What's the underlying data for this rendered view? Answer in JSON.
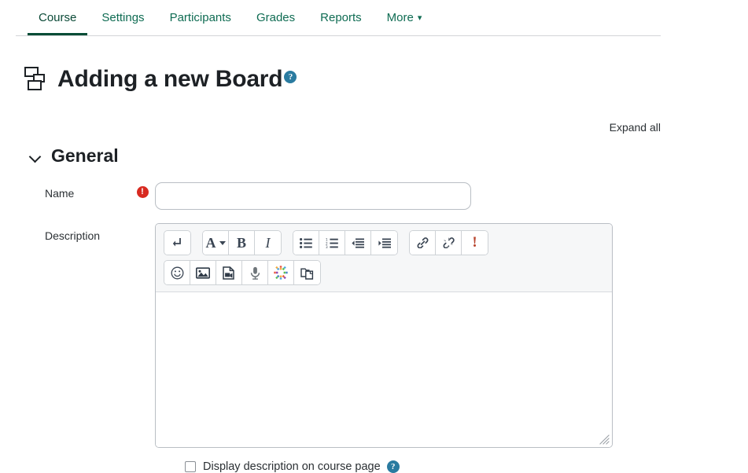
{
  "nav": {
    "tabs": [
      {
        "label": "Course",
        "active": true
      },
      {
        "label": "Settings",
        "active": false
      },
      {
        "label": "Participants",
        "active": false
      },
      {
        "label": "Grades",
        "active": false
      },
      {
        "label": "Reports",
        "active": false
      },
      {
        "label": "More",
        "active": false,
        "caret": "⌄"
      }
    ]
  },
  "header": {
    "title": "Adding a new Board",
    "icon": "board-icon",
    "help_glyph": "?",
    "expand_all": "Expand all"
  },
  "section": {
    "title": "General",
    "collapse_icon": "chevron-down-icon"
  },
  "fields": {
    "name": {
      "label": "Name",
      "value": "",
      "placeholder": "",
      "required_glyph": "!"
    },
    "description": {
      "label": "Description",
      "value": "",
      "placeholder": ""
    },
    "display_description": {
      "label": "Display description on course page",
      "checked": false,
      "help_glyph": "?"
    }
  },
  "editor": {
    "toolbar_rows": [
      [
        {
          "group": [
            {
              "name": "insert-line-break-button",
              "glyph": "⤵"
            }
          ]
        },
        {
          "group": [
            {
              "name": "style-dropdown-button",
              "glyph": "A"
            },
            {
              "name": "bold-button",
              "glyph": "B"
            },
            {
              "name": "italic-button",
              "glyph": "I"
            }
          ]
        },
        {
          "group": [
            {
              "name": "bulleted-list-button",
              "glyph": "list-ul"
            },
            {
              "name": "numbered-list-button",
              "glyph": "list-ol"
            },
            {
              "name": "outdent-button",
              "glyph": "outdent"
            },
            {
              "name": "indent-button",
              "glyph": "indent"
            }
          ]
        },
        {
          "group": [
            {
              "name": "link-button",
              "glyph": "link"
            },
            {
              "name": "unlink-button",
              "glyph": "unlink"
            },
            {
              "name": "accessibility-checker-button",
              "glyph": "!"
            }
          ]
        }
      ],
      [
        {
          "group": [
            {
              "name": "emoji-button",
              "glyph": "smiley"
            },
            {
              "name": "insert-image-button",
              "glyph": "image"
            },
            {
              "name": "insert-media-button",
              "glyph": "media"
            },
            {
              "name": "record-audio-button",
              "glyph": "microphone"
            },
            {
              "name": "h5p-button",
              "glyph": "h5p"
            },
            {
              "name": "manage-files-button",
              "glyph": "files"
            }
          ]
        }
      ]
    ]
  },
  "colors": {
    "brand_green": "#064c36",
    "link_green": "#0f6c53",
    "help_blue": "#2a7ba0",
    "required_red": "#d82a20",
    "toolbar_bg": "#f6f7f8",
    "border_gray": "#b9bec4"
  }
}
